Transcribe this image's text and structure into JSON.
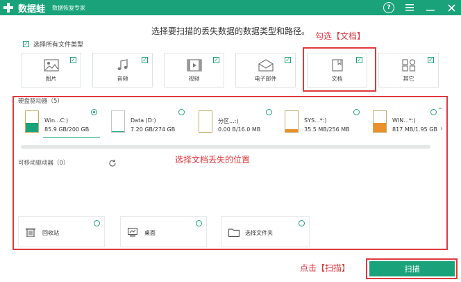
{
  "titlebar": {
    "app_name": "数据蛙",
    "subtitle": "数据恢复专家",
    "help_icon": "help-circle-icon",
    "brand_color": "#1aa37a"
  },
  "instruction": "选择要扫描的丢失数据的数据类型和路径。",
  "select_all_label": "选择所有文件类型",
  "file_types": [
    {
      "label": "图片",
      "icon": "image-icon",
      "checked": true
    },
    {
      "label": "音频",
      "icon": "music-icon",
      "checked": true
    },
    {
      "label": "视频",
      "icon": "video-icon",
      "checked": true
    },
    {
      "label": "电子邮件",
      "icon": "email-icon",
      "checked": true
    },
    {
      "label": "文档",
      "icon": "document-icon",
      "checked": true
    },
    {
      "label": "其它",
      "icon": "other-icon",
      "checked": true
    }
  ],
  "annotations": {
    "check_doc": "勾选【文档】",
    "select_location": "选择文档丢失的位置",
    "click_scan": "点击【扫描】",
    "color": "#e0393e"
  },
  "hard_drives": {
    "title": "硬盘驱动器（5）",
    "drives": [
      {
        "name": "Win...C:)",
        "size": "85.9 GB/200 GB",
        "selected": true,
        "used_fraction": 0.43
      },
      {
        "name": "Data (D:)",
        "size": "7.20 GB/274 GB",
        "selected": false,
        "used_fraction": 0.03
      },
      {
        "name": "分区...:)",
        "size": "0.00  B/16.0 MB",
        "selected": false,
        "used_fraction": 0.0
      },
      {
        "name": "SYS...*:)",
        "size": "35.5 MB/256 MB",
        "selected": false,
        "used_fraction": 0.14
      },
      {
        "name": "WIN...*:)",
        "size": "817 MB/1.95 GB",
        "selected": false,
        "used_fraction": 0.42
      }
    ]
  },
  "removable": {
    "title": "可移动驱动器（0）",
    "refresh_icon": "refresh-icon"
  },
  "locations": [
    {
      "label": "回收站",
      "icon": "recycle-bin-icon"
    },
    {
      "label": "桌面",
      "icon": "desktop-icon"
    },
    {
      "label": "选择文件夹",
      "icon": "folder-icon"
    }
  ],
  "scan_button": "扫描"
}
